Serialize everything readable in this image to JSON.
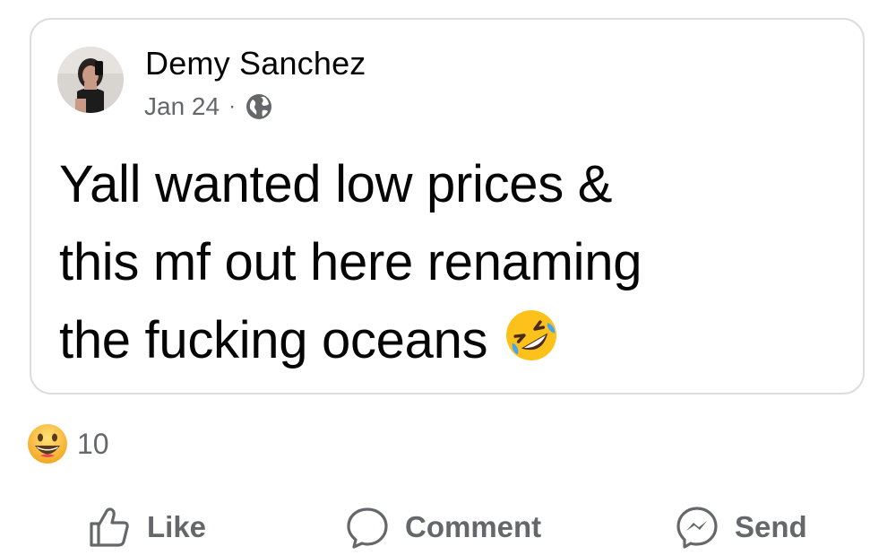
{
  "post": {
    "author": "Demy Sanchez",
    "date": "Jan 24",
    "separator": "·",
    "privacy_icon": "globe-icon",
    "text_lines": [
      "Yall wanted low prices &",
      "this mf out here renaming",
      "the fucking oceans"
    ],
    "trailing_emoji": "rolling-on-floor-laughing-emoji"
  },
  "reactions": {
    "icon": "grinning-face-emoji",
    "count": "10"
  },
  "actions": {
    "like_label": "Like",
    "comment_label": "Comment",
    "send_label": "Send"
  },
  "colors": {
    "text_primary": "#050505",
    "text_secondary": "#65676b",
    "card_border": "#dcdde1",
    "emoji_yellow": "#fcc21b"
  }
}
